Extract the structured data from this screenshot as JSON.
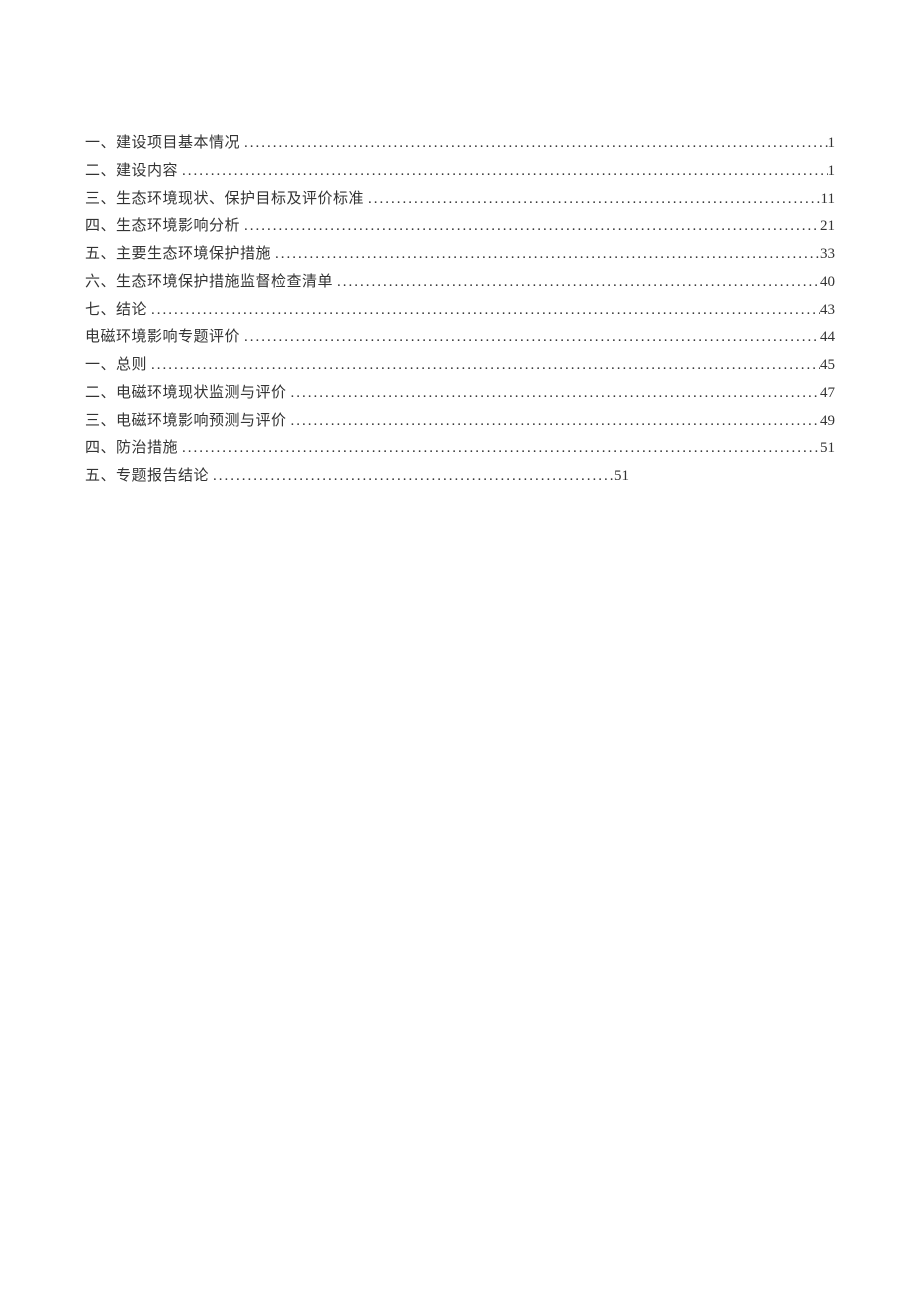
{
  "toc": [
    {
      "title": "一、建设项目基本情况",
      "page": "1",
      "short": false
    },
    {
      "title": "二、建设内容",
      "page": "1",
      "short": false
    },
    {
      "title": "三、生态环境现状、保护目标及评价标准",
      "page": "11",
      "short": false
    },
    {
      "title": "四、生态环境影响分析",
      "page": "21",
      "short": false
    },
    {
      "title": "五、主要生态环境保护措施",
      "page": "33",
      "short": false
    },
    {
      "title": "六、生态环境保护措施监督检查清单",
      "page": "40",
      "short": false
    },
    {
      "title": "七、结论",
      "page": "43",
      "short": false
    },
    {
      "title": "电磁环境影响专题评价",
      "page": "44",
      "short": false
    },
    {
      "title": "一、总则",
      "page": "45",
      "short": false
    },
    {
      "title": "二、电磁环境现状监测与评价",
      "page": "47",
      "short": false
    },
    {
      "title": "三、电磁环境影响预测与评价",
      "page": "49",
      "short": false
    },
    {
      "title": "四、防治措施",
      "page": "51",
      "short": false
    },
    {
      "title": "五、专题报告结论",
      "page": "51",
      "short": true
    }
  ]
}
